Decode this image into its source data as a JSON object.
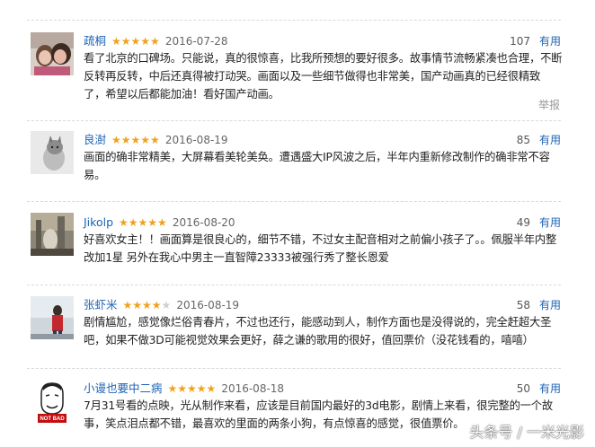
{
  "reviews": [
    {
      "user": "疏桐",
      "rating": 5,
      "stars_on": "★★★★★",
      "stars_off": "",
      "date": "2016-07-28",
      "useful_count": "107",
      "useful_label": "有用",
      "lines": [
        "看了北京的口碑场。只能说，真的很惊喜，比我所预想的要好很多。故事情节流畅紧凑也合理，不断",
        "反转再反转，中后还真得被打动哭。画面以及一些细节做得也非常美，国产动画真的已经很精致",
        "了，希望以后都能加油！看好国产动画。"
      ],
      "report_label": "举报"
    },
    {
      "user": "良澍",
      "rating": 5,
      "stars_on": "★★★★★",
      "stars_off": "",
      "date": "2016-08-19",
      "useful_count": "85",
      "useful_label": "有用",
      "lines": [
        "画面的确非常精美，大屏幕看美轮美奂。遭遇盛大IP风波之后，半年内重新修改制作的确非常不容",
        "易。"
      ]
    },
    {
      "user": "Jikolp",
      "rating": 5,
      "stars_on": "★★★★★",
      "stars_off": "",
      "date": "2016-08-20",
      "useful_count": "49",
      "useful_label": "有用",
      "lines": [
        "好喜欢女主！！画面算是很良心的，细节不错，不过女主配音相对之前偏小孩子了。。佩服半年内整",
        "改加1星 另外在我心中男主一直智障23333被强行秀了整长恩爱"
      ]
    },
    {
      "user": "张虾米",
      "rating": 4,
      "stars_on": "★★★★",
      "stars_off": "★",
      "date": "2016-08-19",
      "useful_count": "58",
      "useful_label": "有用",
      "lines": [
        "剧情尴尬，感觉像烂俗青春片，不过也还行，能感动到人，制作方面也是没得说的，完全赶超大圣",
        "吧，如果不做3D可能视觉效果会更好，薛之谦的歌用的很好，值回票价（没花钱看的，嘻嘻）"
      ]
    },
    {
      "user": "小谩也要中二病",
      "rating": 5,
      "stars_on": "★★★★★",
      "stars_off": "",
      "date": "2016-08-18",
      "useful_count": "50",
      "useful_label": "有用",
      "lines": [
        "7月31号看的点映，光从制作来看，应该是目前国内最好的3d电影，剧情上来看，很完整的一个故",
        "事，笑点泪点都不错，最喜欢的里面的两条小狗，有点惊喜的感觉，很值票价。"
      ],
      "avatar_caption": "NOT BAD"
    }
  ],
  "watermark": "头条号 / 一米光影"
}
